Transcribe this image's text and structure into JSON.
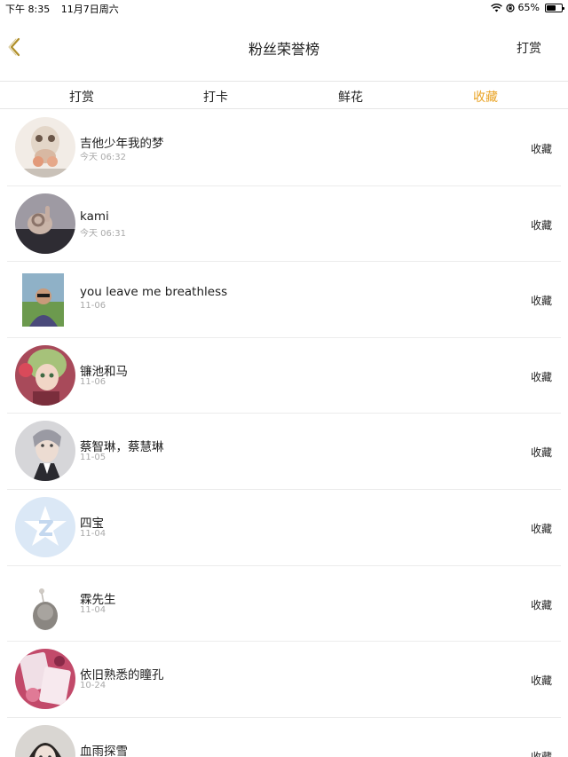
{
  "status": {
    "time": "下午 8:35",
    "date": "11月7日周六",
    "battery": "65%",
    "battery_level": 0.65
  },
  "nav": {
    "title": "粉丝荣誉榜",
    "action": "打赏"
  },
  "tabs": [
    {
      "label": "打赏",
      "active": false
    },
    {
      "label": "打卡",
      "active": false
    },
    {
      "label": "鲜花",
      "active": false
    },
    {
      "label": "收藏",
      "active": true
    }
  ],
  "accent_color": "#e9a325",
  "rows": [
    {
      "name": "吉他少年我的梦",
      "time": "今天 06:32",
      "badge": "收藏"
    },
    {
      "name": "kami",
      "time": "今天 06:31",
      "badge": "收藏"
    },
    {
      "name": "you leave me breathless",
      "time": "11-06",
      "badge": "收藏"
    },
    {
      "name": "镰池和马",
      "time": "11-06",
      "badge": "收藏"
    },
    {
      "name": "蔡智琳，蔡慧琳",
      "time": "11-05",
      "badge": "收藏"
    },
    {
      "name": "四宝",
      "time": "11-04",
      "badge": "收藏"
    },
    {
      "name": "霖先生",
      "time": "11-04",
      "badge": "收藏"
    },
    {
      "name": "依旧熟悉的瞳孔",
      "time": "10-24",
      "badge": "收藏"
    },
    {
      "name": "血雨探雪",
      "time": "",
      "badge": "收藏"
    }
  ]
}
